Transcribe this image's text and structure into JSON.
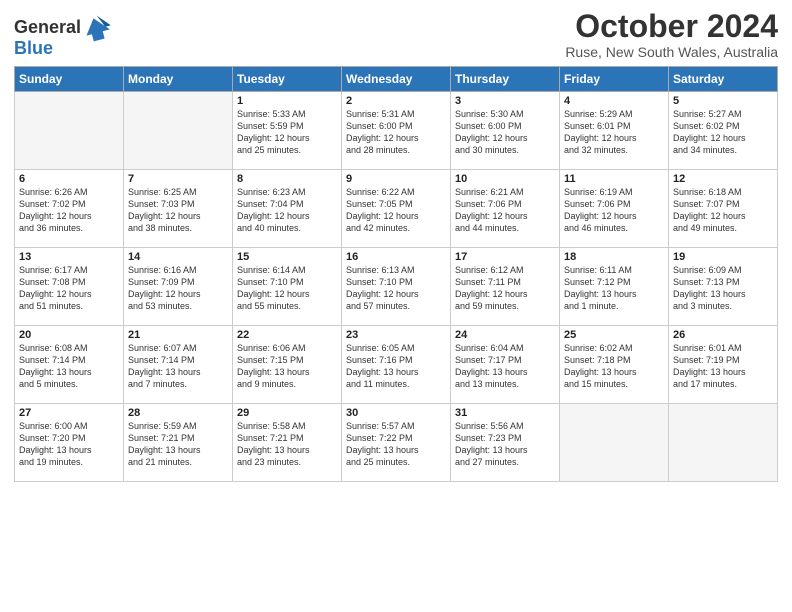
{
  "header": {
    "logo_line1": "General",
    "logo_line2": "Blue",
    "month": "October 2024",
    "location": "Ruse, New South Wales, Australia"
  },
  "weekdays": [
    "Sunday",
    "Monday",
    "Tuesday",
    "Wednesday",
    "Thursday",
    "Friday",
    "Saturday"
  ],
  "weeks": [
    [
      {
        "day": "",
        "info": ""
      },
      {
        "day": "",
        "info": ""
      },
      {
        "day": "1",
        "info": "Sunrise: 5:33 AM\nSunset: 5:59 PM\nDaylight: 12 hours\nand 25 minutes."
      },
      {
        "day": "2",
        "info": "Sunrise: 5:31 AM\nSunset: 6:00 PM\nDaylight: 12 hours\nand 28 minutes."
      },
      {
        "day": "3",
        "info": "Sunrise: 5:30 AM\nSunset: 6:00 PM\nDaylight: 12 hours\nand 30 minutes."
      },
      {
        "day": "4",
        "info": "Sunrise: 5:29 AM\nSunset: 6:01 PM\nDaylight: 12 hours\nand 32 minutes."
      },
      {
        "day": "5",
        "info": "Sunrise: 5:27 AM\nSunset: 6:02 PM\nDaylight: 12 hours\nand 34 minutes."
      }
    ],
    [
      {
        "day": "6",
        "info": "Sunrise: 6:26 AM\nSunset: 7:02 PM\nDaylight: 12 hours\nand 36 minutes."
      },
      {
        "day": "7",
        "info": "Sunrise: 6:25 AM\nSunset: 7:03 PM\nDaylight: 12 hours\nand 38 minutes."
      },
      {
        "day": "8",
        "info": "Sunrise: 6:23 AM\nSunset: 7:04 PM\nDaylight: 12 hours\nand 40 minutes."
      },
      {
        "day": "9",
        "info": "Sunrise: 6:22 AM\nSunset: 7:05 PM\nDaylight: 12 hours\nand 42 minutes."
      },
      {
        "day": "10",
        "info": "Sunrise: 6:21 AM\nSunset: 7:06 PM\nDaylight: 12 hours\nand 44 minutes."
      },
      {
        "day": "11",
        "info": "Sunrise: 6:19 AM\nSunset: 7:06 PM\nDaylight: 12 hours\nand 46 minutes."
      },
      {
        "day": "12",
        "info": "Sunrise: 6:18 AM\nSunset: 7:07 PM\nDaylight: 12 hours\nand 49 minutes."
      }
    ],
    [
      {
        "day": "13",
        "info": "Sunrise: 6:17 AM\nSunset: 7:08 PM\nDaylight: 12 hours\nand 51 minutes."
      },
      {
        "day": "14",
        "info": "Sunrise: 6:16 AM\nSunset: 7:09 PM\nDaylight: 12 hours\nand 53 minutes."
      },
      {
        "day": "15",
        "info": "Sunrise: 6:14 AM\nSunset: 7:10 PM\nDaylight: 12 hours\nand 55 minutes."
      },
      {
        "day": "16",
        "info": "Sunrise: 6:13 AM\nSunset: 7:10 PM\nDaylight: 12 hours\nand 57 minutes."
      },
      {
        "day": "17",
        "info": "Sunrise: 6:12 AM\nSunset: 7:11 PM\nDaylight: 12 hours\nand 59 minutes."
      },
      {
        "day": "18",
        "info": "Sunrise: 6:11 AM\nSunset: 7:12 PM\nDaylight: 13 hours\nand 1 minute."
      },
      {
        "day": "19",
        "info": "Sunrise: 6:09 AM\nSunset: 7:13 PM\nDaylight: 13 hours\nand 3 minutes."
      }
    ],
    [
      {
        "day": "20",
        "info": "Sunrise: 6:08 AM\nSunset: 7:14 PM\nDaylight: 13 hours\nand 5 minutes."
      },
      {
        "day": "21",
        "info": "Sunrise: 6:07 AM\nSunset: 7:14 PM\nDaylight: 13 hours\nand 7 minutes."
      },
      {
        "day": "22",
        "info": "Sunrise: 6:06 AM\nSunset: 7:15 PM\nDaylight: 13 hours\nand 9 minutes."
      },
      {
        "day": "23",
        "info": "Sunrise: 6:05 AM\nSunset: 7:16 PM\nDaylight: 13 hours\nand 11 minutes."
      },
      {
        "day": "24",
        "info": "Sunrise: 6:04 AM\nSunset: 7:17 PM\nDaylight: 13 hours\nand 13 minutes."
      },
      {
        "day": "25",
        "info": "Sunrise: 6:02 AM\nSunset: 7:18 PM\nDaylight: 13 hours\nand 15 minutes."
      },
      {
        "day": "26",
        "info": "Sunrise: 6:01 AM\nSunset: 7:19 PM\nDaylight: 13 hours\nand 17 minutes."
      }
    ],
    [
      {
        "day": "27",
        "info": "Sunrise: 6:00 AM\nSunset: 7:20 PM\nDaylight: 13 hours\nand 19 minutes."
      },
      {
        "day": "28",
        "info": "Sunrise: 5:59 AM\nSunset: 7:21 PM\nDaylight: 13 hours\nand 21 minutes."
      },
      {
        "day": "29",
        "info": "Sunrise: 5:58 AM\nSunset: 7:21 PM\nDaylight: 13 hours\nand 23 minutes."
      },
      {
        "day": "30",
        "info": "Sunrise: 5:57 AM\nSunset: 7:22 PM\nDaylight: 13 hours\nand 25 minutes."
      },
      {
        "day": "31",
        "info": "Sunrise: 5:56 AM\nSunset: 7:23 PM\nDaylight: 13 hours\nand 27 minutes."
      },
      {
        "day": "",
        "info": ""
      },
      {
        "day": "",
        "info": ""
      }
    ]
  ]
}
